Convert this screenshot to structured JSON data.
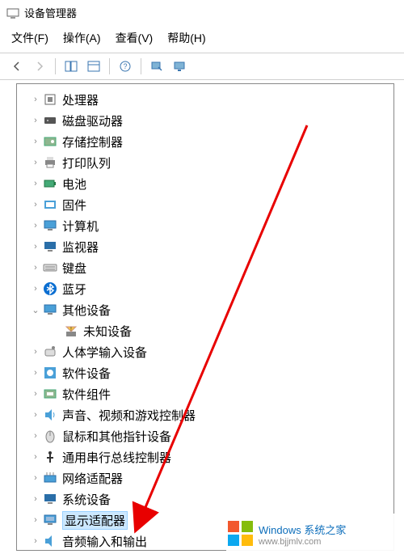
{
  "window": {
    "title": "设备管理器"
  },
  "menu": {
    "file": "文件(F)",
    "action": "操作(A)",
    "view": "查看(V)",
    "help": "帮助(H)"
  },
  "tree": {
    "items": [
      {
        "icon": "cpu",
        "label": "处理器",
        "exp": "›",
        "depth": 1
      },
      {
        "icon": "disk",
        "label": "磁盘驱动器",
        "exp": "›",
        "depth": 1
      },
      {
        "icon": "storage",
        "label": "存储控制器",
        "exp": "›",
        "depth": 1
      },
      {
        "icon": "printer",
        "label": "打印队列",
        "exp": "›",
        "depth": 1
      },
      {
        "icon": "battery",
        "label": "电池",
        "exp": "›",
        "depth": 1
      },
      {
        "icon": "firmware",
        "label": "固件",
        "exp": "›",
        "depth": 1
      },
      {
        "icon": "computer",
        "label": "计算机",
        "exp": "›",
        "depth": 1
      },
      {
        "icon": "monitor",
        "label": "监视器",
        "exp": "›",
        "depth": 1
      },
      {
        "icon": "keyboard",
        "label": "键盘",
        "exp": "›",
        "depth": 1
      },
      {
        "icon": "bluetooth",
        "label": "蓝牙",
        "exp": "›",
        "depth": 1
      },
      {
        "icon": "other",
        "label": "其他设备",
        "exp": "⌄",
        "depth": 1
      },
      {
        "icon": "unknown",
        "label": "未知设备",
        "exp": "",
        "depth": 2
      },
      {
        "icon": "hid",
        "label": "人体学输入设备",
        "exp": "›",
        "depth": 1
      },
      {
        "icon": "software",
        "label": "软件设备",
        "exp": "›",
        "depth": 1
      },
      {
        "icon": "component",
        "label": "软件组件",
        "exp": "›",
        "depth": 1
      },
      {
        "icon": "audio",
        "label": "声音、视频和游戏控制器",
        "exp": "›",
        "depth": 1
      },
      {
        "icon": "mouse",
        "label": "鼠标和其他指针设备",
        "exp": "›",
        "depth": 1
      },
      {
        "icon": "usb",
        "label": "通用串行总线控制器",
        "exp": "›",
        "depth": 1
      },
      {
        "icon": "network",
        "label": "网络适配器",
        "exp": "›",
        "depth": 1
      },
      {
        "icon": "system",
        "label": "系统设备",
        "exp": "›",
        "depth": 1
      },
      {
        "icon": "display",
        "label": "显示适配器",
        "exp": "›",
        "depth": 1,
        "selected": true
      },
      {
        "icon": "audioio",
        "label": "音频输入和输出",
        "exp": "›",
        "depth": 1
      }
    ]
  },
  "watermark": {
    "line1": "Windows 系统之家",
    "line2": "www.bjjmlv.com"
  }
}
